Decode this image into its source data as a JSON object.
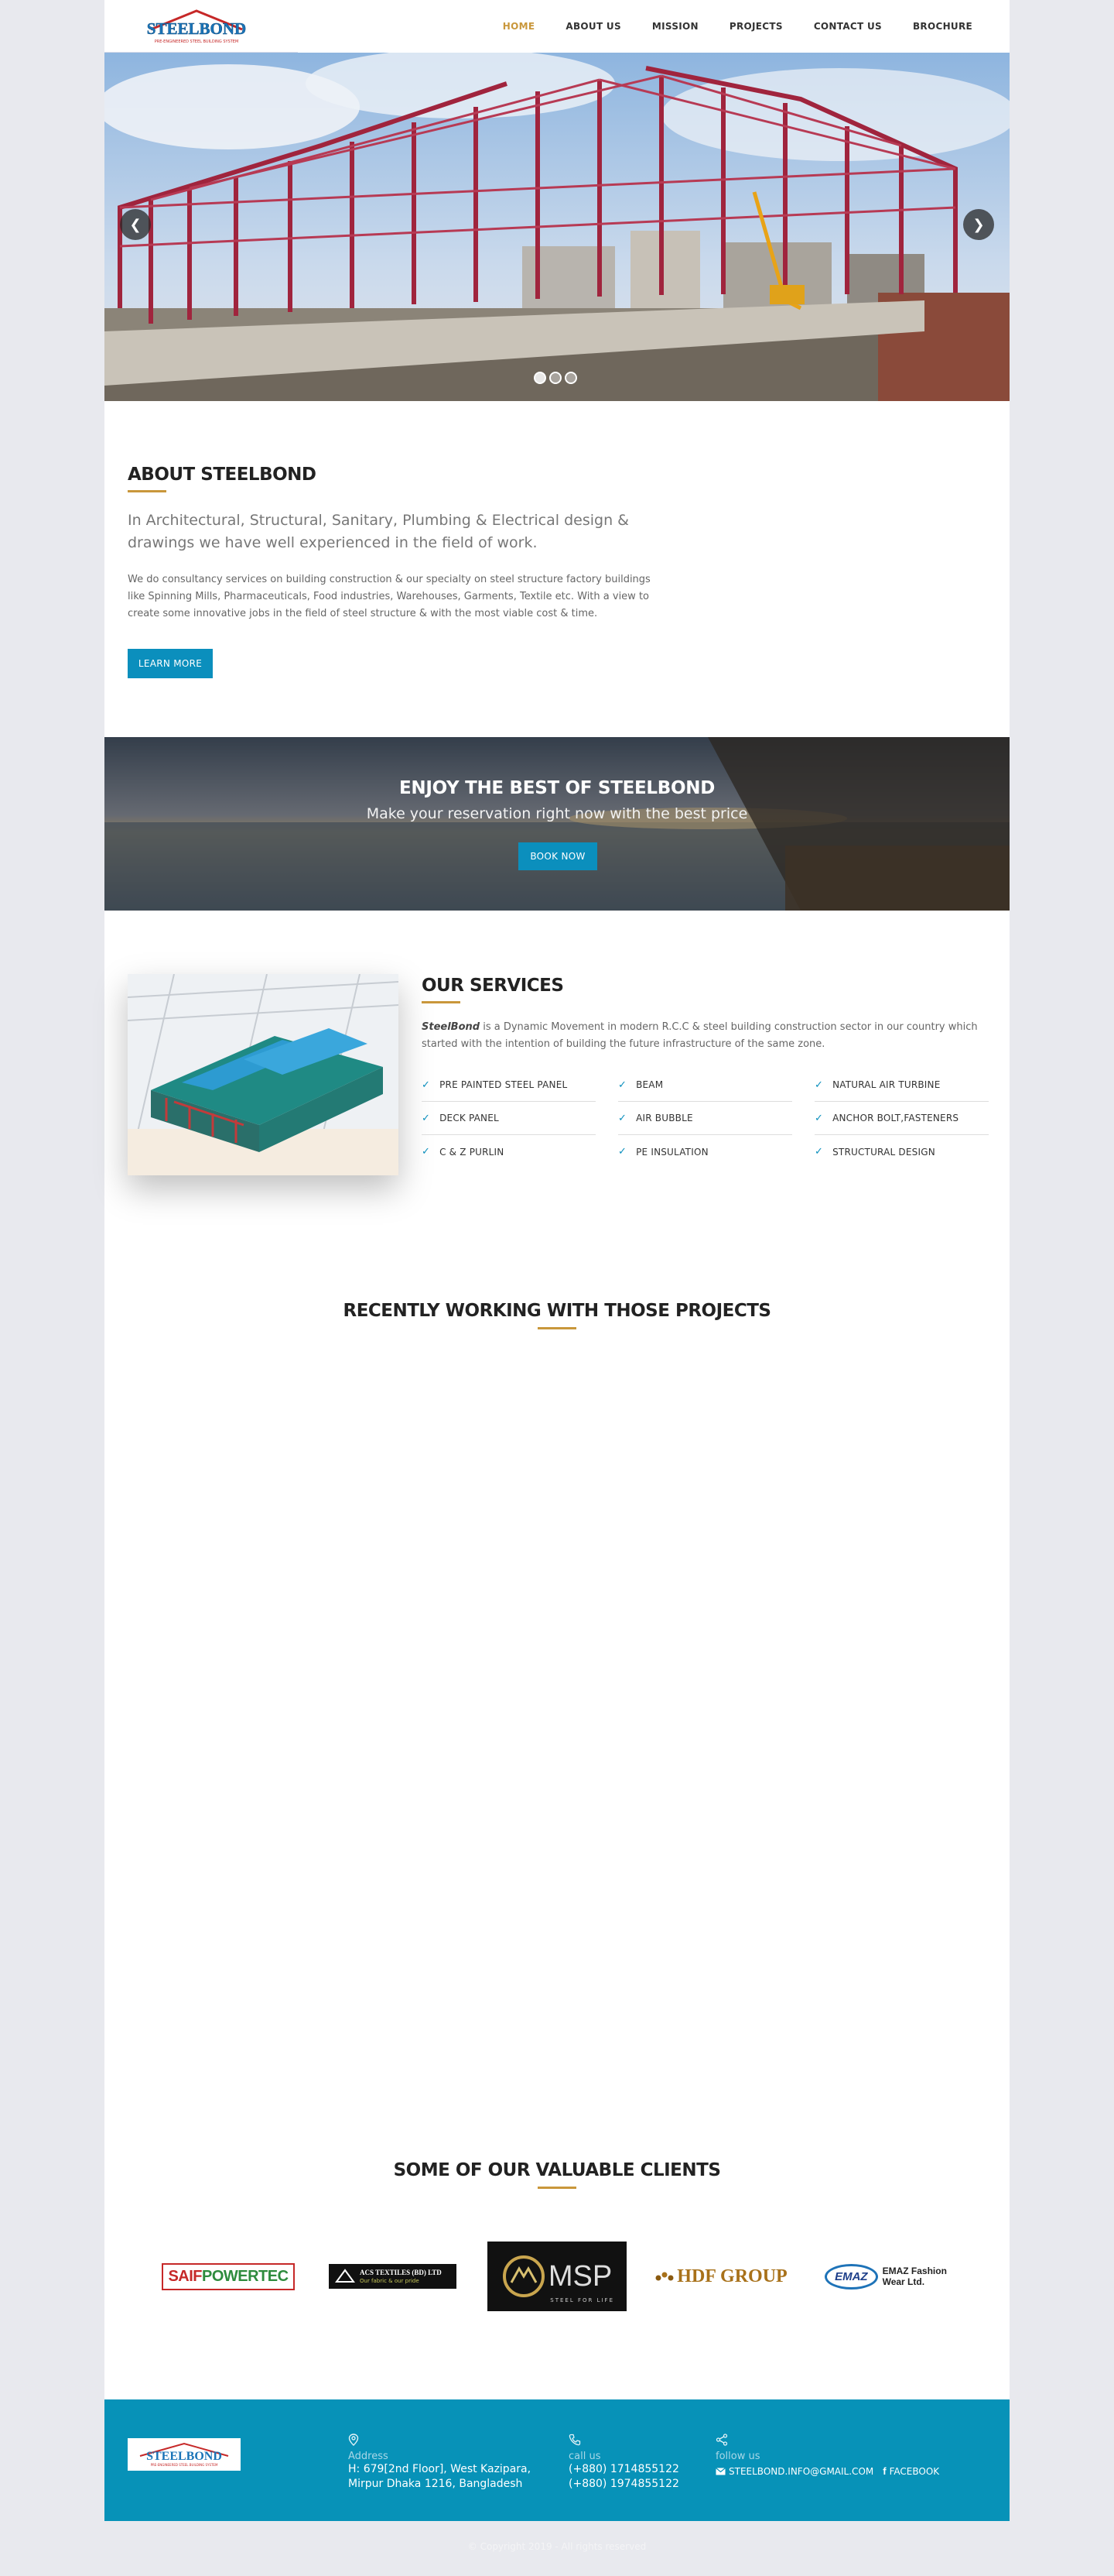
{
  "header": {
    "logo_text": "STEELBOND",
    "logo_tagline": "PRE-ENGINEERED STEEL BUILDING SYSTEM",
    "nav": [
      {
        "label": "HOME",
        "active": true
      },
      {
        "label": "ABOUT US",
        "active": false
      },
      {
        "label": "MISSION",
        "active": false
      },
      {
        "label": "PROJECTS",
        "active": false
      },
      {
        "label": "CONTACT US",
        "active": false
      },
      {
        "label": "BROCHURE",
        "active": false
      }
    ]
  },
  "slider": {
    "prev_icon": "chevron-left-icon",
    "next_icon": "chevron-right-icon",
    "slide_count": 3
  },
  "about": {
    "title": "ABOUT STEELBOND",
    "lead": "In Architectural, Structural, Sanitary, Plumbing & Electrical design & drawings we have well experienced in the field of work.",
    "body": "We do consultancy services on building construction & our specialty on steel structure factory buildings like Spinning Mills, Pharmaceuticals, Food industries, Warehouses, Garments, Textile etc. With a view to create some innovative jobs in the field of steel structure & with the most viable cost & time.",
    "button": "LEARN MORE"
  },
  "banner": {
    "title": "ENJOY THE BEST OF STEELBOND",
    "subtitle": "Make your reservation right now with the best price",
    "button": "BOOK NOW"
  },
  "services": {
    "title": "OUR SERVICES",
    "desc_brand": "SteelBond",
    "desc": " is a Dynamic Movement in modern R.C.C & steel building construction sector in our country which started with the intention of building the future infrastructure of the same zone.",
    "items": [
      "PRE PAINTED STEEL PANEL",
      "BEAM",
      "NATURAL AIR TURBINE",
      "DECK PANEL",
      "AIR BUBBLE",
      "ANCHOR BOLT,FASTENERS",
      "C & Z PURLIN",
      "PE INSULATION",
      "STRUCTURAL DESIGN"
    ],
    "check_icon": "check-icon"
  },
  "projects": {
    "title": "RECENTLY WORKING WITH THOSE PROJECTS"
  },
  "clients": {
    "title": "SOME OF OUR VALUABLE CLIENTS",
    "logos": [
      {
        "name": "SAIF POWERTEC",
        "part1": "SAIF",
        "part2": "POWERTEC"
      },
      {
        "name": "ACS TEXTILES (BD) LTD",
        "line1": "ACS TEXTILES (BD) LTD",
        "line2": "Our fabric & our pride"
      },
      {
        "name": "MSP",
        "text": "MSP",
        "tagline": "STEEL FOR LIFE"
      },
      {
        "name": "HDF GROUP",
        "text": "HDF GROUP"
      },
      {
        "name": "EMAZ Fashion Wear Ltd.",
        "badge": "EMAZ",
        "line1": "EMAZ Fashion",
        "line2": "Wear Ltd."
      }
    ]
  },
  "footer": {
    "address_label": "Address",
    "address_line1": "H: 679[2nd Floor], West Kazipara,",
    "address_line2": "Mirpur Dhaka 1216, Bangladesh",
    "call_label": "call us",
    "phone1": "(+880) 1714855122",
    "phone2": "(+880) 1974855122",
    "follow_label": "follow us",
    "email": "STEELBOND.INFO@GMAIL.COM",
    "facebook": "FACEBOOK",
    "pin_icon": "map-pin-icon",
    "phone_icon": "phone-icon",
    "share_icon": "share-icon",
    "mail_icon": "envelope-icon",
    "fb_icon": "facebook-icon"
  },
  "copyright": "© Copyright 2019 - All rights reserved"
}
